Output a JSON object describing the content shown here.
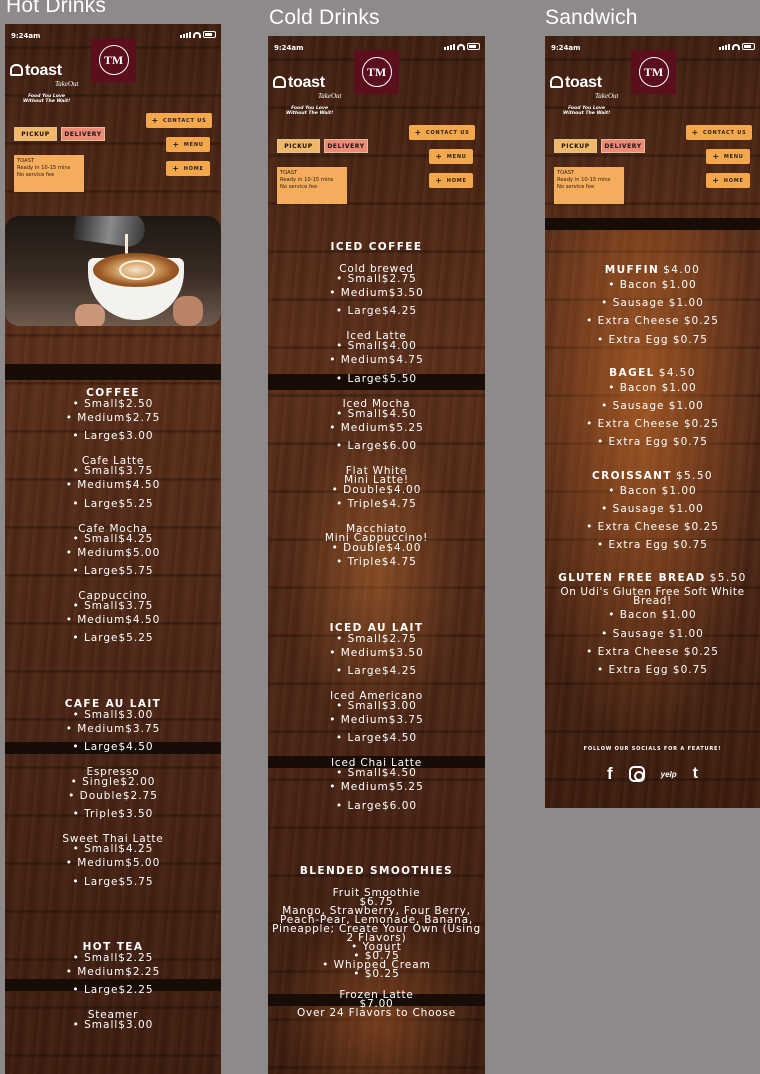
{
  "columns": [
    {
      "title": "Hot Drinks",
      "status_time": "9:24am",
      "brand": "toast",
      "brand_sub": "TakeOut",
      "tagline": [
        "Food You Love",
        "Without The Wait!"
      ],
      "badge": "TM",
      "pickup": "PICKUP",
      "delivery": "DELIVERY",
      "contact": "CONTACT US",
      "menu_btn": "MENU",
      "home_btn": "HOME",
      "toast_box": [
        "TOAST",
        "Ready in 10-15 mins",
        "No service fee"
      ],
      "sections": [
        {
          "title": "COFFEE",
          "items": [
            {
              "name": "",
              "options": [
                "• Small$2.50",
                "• Medium$2.75",
                "• Large$3.00"
              ]
            },
            {
              "name": "Cafe Latte",
              "options": [
                "• Small$3.75",
                "• Medium$4.50",
                "• Large$5.25"
              ]
            },
            {
              "name": "Cafe Mocha",
              "options": [
                "• Small$4.25",
                "• Medium$5.00",
                "• Large$5.75"
              ]
            },
            {
              "name": "Cappuccino",
              "options": [
                "• Small$3.75",
                "• Medium$4.50",
                "• Large$5.25"
              ]
            }
          ]
        },
        {
          "title": "CAFE AU LAIT",
          "items": [
            {
              "name": "",
              "options": [
                "• Small$3.00",
                "• Medium$3.75",
                "• Large$4.50"
              ]
            },
            {
              "name": "Espresso",
              "options": [
                "• Single$2.00",
                "• Double$2.75",
                "• Triple$3.50"
              ]
            },
            {
              "name": "Sweet Thai Latte",
              "options": [
                "• Small$4.25",
                "• Medium$5.00",
                "• Large$5.75"
              ]
            }
          ]
        },
        {
          "title": "HOT TEA",
          "items": [
            {
              "name": "",
              "options": [
                "• Small$2.25",
                "• Medium$2.25",
                "• Large$2.25"
              ]
            },
            {
              "name": "Steamer",
              "options": [
                "• Small$3.00"
              ]
            }
          ]
        }
      ]
    },
    {
      "title": "Cold Drinks",
      "status_time": "9:24am",
      "brand": "toast",
      "brand_sub": "TakeOut",
      "tagline": [
        "Food You Love",
        "Without The Wait!"
      ],
      "badge": "TM",
      "pickup": "PICKUP",
      "delivery": "DELIVERY",
      "contact": "CONTACT US",
      "menu_btn": "MENU",
      "home_btn": "HOME",
      "toast_box": [
        "TOAST",
        "Ready in 10-15 mins",
        "No service fee"
      ],
      "sections": [
        {
          "title": "ICED COFFEE",
          "items": [
            {
              "name": "Cold brewed",
              "options": [
                "• Small$2.75",
                "• Medium$3.50",
                "• Large$4.25"
              ]
            },
            {
              "name": "Iced Latte",
              "options": [
                "• Small$4.00",
                "• Medium$4.75",
                "• Large$5.50"
              ]
            },
            {
              "name": "Iced Mocha",
              "options": [
                "• Small$4.50",
                "• Medium$5.25",
                "• Large$6.00"
              ]
            },
            {
              "name": "Flat White\nMini Latte!",
              "options": [
                "• Double$4.00",
                "• Triple$4.75"
              ]
            },
            {
              "name": "Macchiato\nMini Cappuccino!",
              "options": [
                "• Double$4.00",
                "• Triple$4.75"
              ]
            }
          ]
        },
        {
          "title": "ICED AU LAIT",
          "items": [
            {
              "name": "",
              "options": [
                "• Small$2.75",
                "• Medium$3.50",
                "• Large$4.25"
              ]
            },
            {
              "name": "Iced Americano",
              "options": [
                "• Small$3.00",
                "• Medium$3.75",
                "• Large$4.50"
              ]
            },
            {
              "name": "Iced Chai Latte",
              "options": [
                "• Small$4.50",
                "• Medium$5.25",
                "• Large$6.00"
              ]
            }
          ]
        },
        {
          "title": "BLENDED SMOOTHIES",
          "items": [
            {
              "name": "Fruit Smoothie\n$6.75\nMango, Strawberry, Four Berry, Peach-Pear, Lemonade, Banana, Pineapple; Create Your Own (Using 2 Flavors)",
              "options": [
                "• Yogurt\n• $0.75",
                "• Whipped Cream\n• $0.25"
              ]
            },
            {
              "name": "Frozen Latte\n$7.00\nOver 24 Flavors to Choose",
              "options": []
            }
          ]
        }
      ]
    },
    {
      "title": "Sandwich",
      "status_time": "9:24am",
      "brand": "toast",
      "brand_sub": "TakeOut",
      "tagline": [
        "Food You Love",
        "Without The Wait!"
      ],
      "badge": "TM",
      "pickup": "PICKUP",
      "delivery": "DELIVERY",
      "contact": "CONTACT US",
      "menu_btn": "MENU",
      "home_btn": "HOME",
      "toast_box": [
        "TOAST",
        "Ready in 10-15 mins",
        "No service fee"
      ],
      "sections": [
        {
          "title": "MUFFIN",
          "price": "$4.00",
          "sub": "",
          "options": [
            "• Bacon $1.00",
            "• Sausage $1.00",
            "• Extra Cheese $0.25",
            "• Extra Egg $0.75"
          ]
        },
        {
          "title": "BAGEL",
          "price": "$4.50",
          "sub": "",
          "options": [
            "• Bacon $1.00",
            "• Sausage $1.00",
            "• Extra Cheese $0.25",
            "• Extra Egg $0.75"
          ]
        },
        {
          "title": "CROISSANT",
          "price": "$5.50",
          "sub": "",
          "options": [
            "• Bacon $1.00",
            "• Sausage $1.00",
            "• Extra Cheese $0.25",
            "• Extra Egg $0.75"
          ]
        },
        {
          "title": "GLUTEN FREE BREAD",
          "price": "$5.50",
          "sub": "On Udi's Gluten Free Soft White Bread!",
          "options": [
            "• Bacon $1.00",
            "• Sausage $1.00",
            "• Extra Cheese $0.25",
            "• Extra Egg $0.75"
          ]
        }
      ],
      "socials_title": "FOLLOW OUR SOCIALS FOR A FEATURE!",
      "socials": [
        "facebook-icon",
        "instagram-icon",
        "yelp-icon",
        "tumblr-icon"
      ]
    }
  ],
  "colors": {
    "canvas": "#8f8a8a",
    "pickup": "#f2b86a",
    "delivery": "#f08a78",
    "nav_button": "#f4a84b",
    "toast_box": "#f4ad5c",
    "badge": "#5b0e1c"
  }
}
